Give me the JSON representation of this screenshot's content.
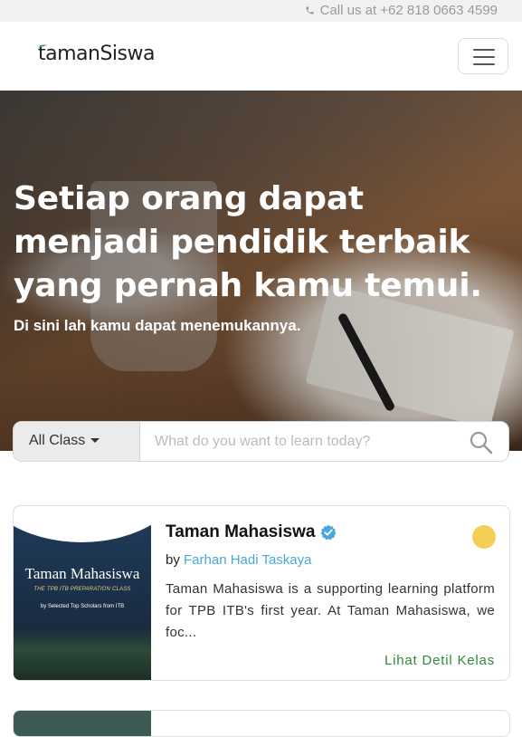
{
  "topbar": {
    "call_text": "Call us at +62 818 0663 4599"
  },
  "brand": {
    "logo_text": "tamanSiswa"
  },
  "hero": {
    "headline": "Setiap orang dapat menjadi pendidik terbaik yang pernah kamu temui.",
    "subheadline": "Di sini lah kamu dapat menemukannya."
  },
  "search": {
    "category_selected": "All Class",
    "placeholder": "What do you want to learn today?"
  },
  "classes": [
    {
      "title": "Taman Mahasiswa",
      "by_label": "by",
      "author": "Farhan Hadi Taskaya",
      "description": "Taman Mahasiswa is a supporting learning platform for TPB ITB's first year. At Taman Mahasiswa, we foc...",
      "detail_link": "Lihat Detil Kelas",
      "status_color": "#f5cf55",
      "thumb": {
        "title": "Taman Mahasiswa",
        "subtitle": "THE TPB ITB PREPARATION CLASS",
        "tagline": "by Selected Top Scholars from ITB"
      }
    }
  ],
  "colors": {
    "accent_link": "#4aa8d8",
    "detail_green": "#2e8b3a",
    "verified_blue": "#4aa8d8"
  },
  "icons": {
    "phone": "phone-icon",
    "menu": "hamburger-menu-icon",
    "search": "search-icon",
    "verified": "verified-check-icon"
  }
}
